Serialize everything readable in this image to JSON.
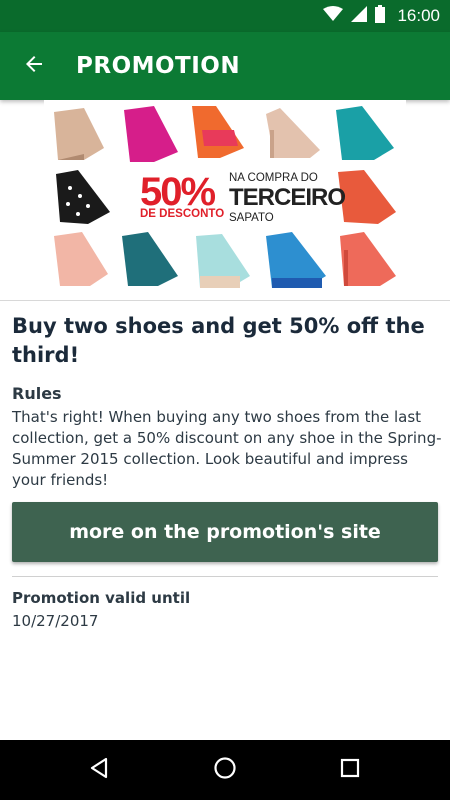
{
  "status_bar": {
    "time": "16:00"
  },
  "app_bar": {
    "title": "PROMOTION"
  },
  "banner": {
    "percent": "50%",
    "discount_label": "DE DESCONTO",
    "na_compra": "NA COMPRA DO",
    "terceiro": "TERCEIRO",
    "sapato": "SAPATO"
  },
  "promotion": {
    "title": "Buy two shoes and get 50% off the third!",
    "rules_label": "Rules",
    "rules_text": "That's right! When buying any two shoes from the last collection, get a 50% discount on any shoe in the Spring-Summer 2015 collection. Look beautiful and impress your friends!",
    "button_label": "more on the promotion's site",
    "valid_label": "Promotion valid until",
    "valid_date": "10/27/2017"
  },
  "colors": {
    "status_bar": "#0a6b2c",
    "app_bar": "#0c7a34",
    "button": "#3e6350",
    "banner_red": "#e0202a"
  }
}
